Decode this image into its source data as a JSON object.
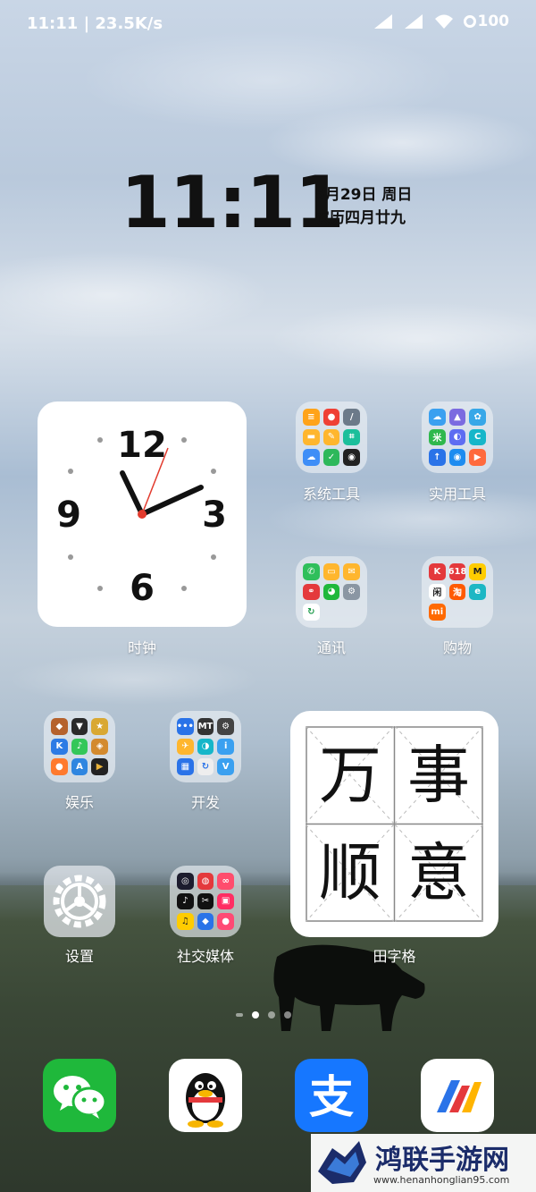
{
  "status_bar": {
    "time_speed": "11:11 | 23.5K/s",
    "battery": "100"
  },
  "clock_widget": {
    "time": "11:11",
    "date": "5月29日  周日",
    "lunar_date": "农历四月廿九"
  },
  "analog_clock": {
    "numbers": [
      "12",
      "3",
      "6",
      "9"
    ],
    "label": "时钟"
  },
  "folders": {
    "system_tools": "系统工具",
    "utilities": "实用工具",
    "communication": "通讯",
    "shopping": "购物",
    "entertainment": "娱乐",
    "development": "开发",
    "social_media": "社交媒体"
  },
  "tianzi_widget": {
    "chars": [
      "万",
      "事",
      "顺",
      "意"
    ],
    "label": "田字格"
  },
  "settings": {
    "label": "设置"
  },
  "dock": {
    "apps": [
      "wechat-icon",
      "qq-icon",
      "alipay-icon",
      "yingyongbao-icon"
    ]
  },
  "watermark": {
    "title": "鸿联手游网",
    "url": "www.henanhonglian95.com"
  },
  "colors": {
    "wechat": "#1fb83b",
    "alipay": "#1677ff",
    "clock_second_hand": "#e23b2e"
  }
}
